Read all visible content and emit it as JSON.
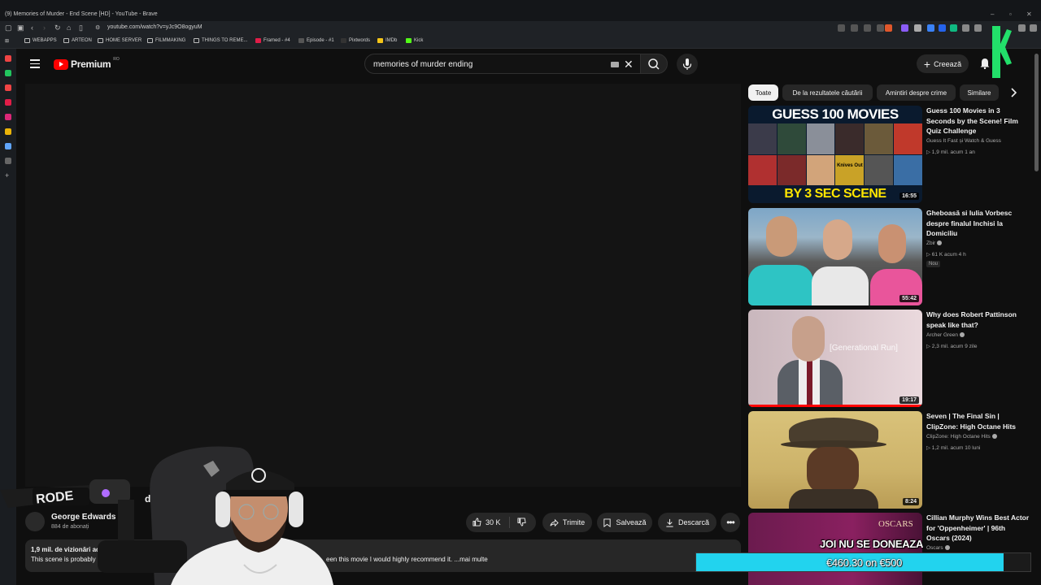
{
  "browser": {
    "window_title": "(9) Memories of Murder - End Scene [HD] - YouTube - Brave",
    "url": "youtube.com/watch?v=yJc9O8ogyuM",
    "bookmarks": [
      "WEBAPPS",
      "ARTEON",
      "HOME SERVER",
      "FILMMAKING",
      "THINGS TO REME...",
      "Framed - #4",
      "Episode - #1",
      "Pixtwords",
      "IMDb",
      "Kick"
    ]
  },
  "header": {
    "logo": "Premium",
    "country": "RO",
    "search_query": "memories of murder ending",
    "create_label": "Creează"
  },
  "video": {
    "title_partial": "d Sc",
    "channel": "George Edwards",
    "subscribers": "884 de abonați",
    "likes": "30 K",
    "share": "Trimite",
    "save": "Salvează",
    "download": "Descarcă",
    "stats": "1,9 mil. de vizionări  acum 14",
    "desc_start": "This scene is probably the",
    "desc_end": "een this movie I would highly recommend it.  ...mai multe"
  },
  "chips": [
    "Toate",
    "De la rezultatele căutării",
    "Amintiri despre crime",
    "Similare"
  ],
  "recommendations": [
    {
      "title": "Guess 100 Movies in 3 Seconds by the Scene! Film Quiz Challenge",
      "channel": "Guess It Fast și Watch & Guess",
      "meta": "▷ 1,9 mil.  acum 1 an",
      "duration": "16:55",
      "thumb_top": "GUESS 100 MOVIES",
      "thumb_bottom": "BY 3 SEC SCENE",
      "thumb_poster": "Knives Out",
      "verified": false,
      "badge": ""
    },
    {
      "title": "Gheboasă si Iulia Vorbesc despre finalul Inchisi la Domiciliu",
      "channel": "Zbir",
      "meta": "▷ 61 K  acum 4 h",
      "duration": "55:42",
      "verified": true,
      "badge": "Nou"
    },
    {
      "title": "Why does Robert Pattinson speak like that?",
      "channel": "Archer Green",
      "meta": "▷ 2,3 mil.  acum 9 zile",
      "duration": "19:17",
      "thumb_text": "[Generational Run]",
      "verified": true,
      "badge": ""
    },
    {
      "title": "Seven | The Final Sin | ClipZone: High Octane Hits",
      "channel": "ClipZone: High Octane Hits",
      "meta": "▷ 1,2 mil.  acum 10 luni",
      "duration": "8:24",
      "verified": true,
      "badge": ""
    },
    {
      "title": "Cillian Murphy Wins Best Actor for 'Oppenheimer' | 96th Oscars (2024)",
      "channel": "Oscars",
      "meta": "",
      "duration": "",
      "thumb_text": "OSCARS",
      "verified": true,
      "badge": ""
    }
  ],
  "overlay": {
    "mic_brand": "RODE",
    "donation_text": "JOI NU SE DONEAZA",
    "donation_amount": "€460.30 on €500",
    "donation_progress": 0.92,
    "accent": "#22d3ee"
  }
}
